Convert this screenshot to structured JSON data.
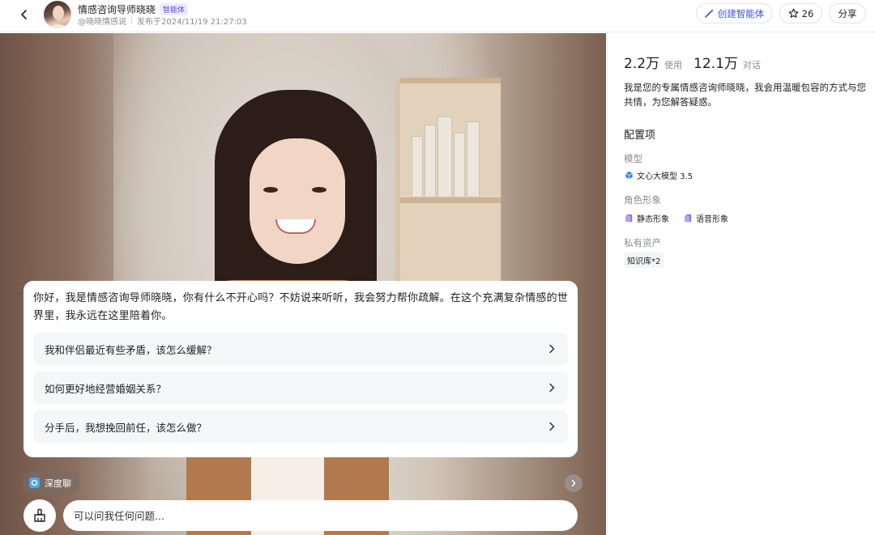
{
  "header": {
    "title": "情感咨询导师晓晓",
    "tag": "智能体",
    "author": "@晓晓情感说",
    "published": "发布于2024/11/19 21:27:03",
    "create_label": "创建智能体",
    "fav_count": "26",
    "share_label": "分享"
  },
  "chat": {
    "greeting": "你好，我是情感咨询导师晓晓，你有什么不开心吗？不妨说来听听，我会努力帮你疏解。在这个充满复杂情感的世界里，我永远在这里陪着你。",
    "suggestions": [
      "我和伴侣最近有些矛盾，该怎么缓解？",
      "如何更好地经营婚姻关系？",
      "分手后，我想挽回前任，该怎么做？"
    ],
    "deep_chat_label": "深度聊",
    "input_placeholder": "可以问我任何问题..."
  },
  "panel": {
    "uses_value": "2.2万",
    "uses_label": "使用",
    "chats_value": "12.1万",
    "chats_label": "对话",
    "description": "我是您的专属情感咨询师晓晓，我会用温暖包容的方式与您共情，为您解答疑惑。",
    "config_title": "配置项",
    "model_label": "模型",
    "model_value": "文心大模型 3.5",
    "persona_label": "角色形象",
    "persona_static": "静态形象",
    "persona_voice": "语音形象",
    "assets_label": "私有资产",
    "assets_value": "知识库*2"
  },
  "colors": {
    "accent": "#3b54e8",
    "tag_bg": "#eeebff",
    "tag_text": "#5b4bd4"
  },
  "icons": [
    "back-arrow-icon",
    "magic-wand-icon",
    "star-icon",
    "chevron-right-icon",
    "deep-chat-icon",
    "broom-icon",
    "model-cube-icon",
    "persona-card-icon"
  ]
}
